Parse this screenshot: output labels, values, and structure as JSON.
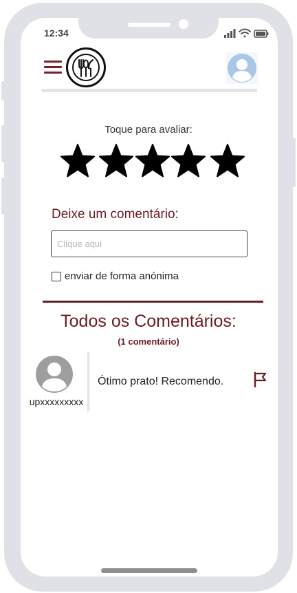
{
  "status_bar": {
    "time": "12:34",
    "icons": [
      "signal-icon",
      "wifi-icon",
      "battery-icon"
    ]
  },
  "header": {
    "menu_icon": "hamburger-menu-icon",
    "logo_icon": "fork-spoon-knife-logo",
    "avatar_icon": "user-avatar-icon"
  },
  "rating": {
    "label": "Toque para avaliar:",
    "stars_total": 5,
    "stars_filled": 5
  },
  "comment_form": {
    "label": "Deixe um comentário:",
    "placeholder": "Clique aqui",
    "value": "",
    "anonymous_label": "enviar de forma anónima",
    "anonymous_checked": false
  },
  "comments_section": {
    "title": "Todos os Comentários:",
    "count_text": "(1 comentário)",
    "items": [
      {
        "username": "upxxxxxxxxx",
        "text": "Ótimo prato! Recomendo.",
        "avatar_icon": "user-avatar-icon",
        "flag_icon": "flag-icon"
      }
    ]
  },
  "colors": {
    "accent": "#6b1a22",
    "frame": "#dfe1e6",
    "avatar_blue": "#a9c7e8",
    "avatar_gray": "#9e9e9e"
  }
}
